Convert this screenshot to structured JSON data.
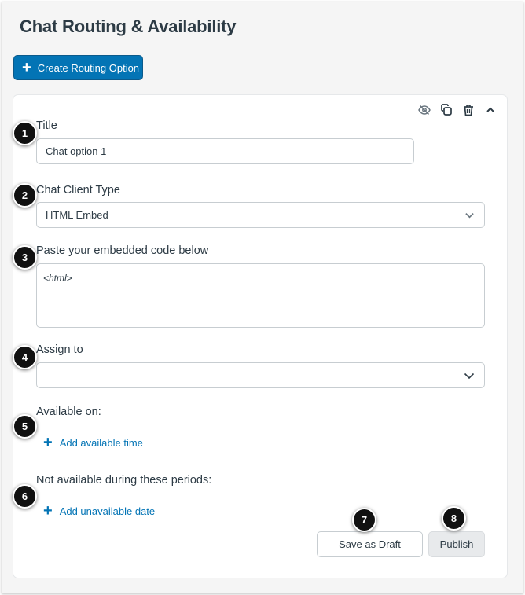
{
  "page": {
    "title": "Chat Routing & Availability"
  },
  "toolbar": {
    "create_label": "Create Routing Option"
  },
  "card": {
    "tools": [
      "eye-slash-icon",
      "copy-icon",
      "trash-icon",
      "chevron-up-icon"
    ],
    "title_label": "Title",
    "title_value": "Chat option 1",
    "client_type_label": "Chat Client Type",
    "client_type_value": "HTML Embed",
    "embed_label": "Paste your embedded code below",
    "embed_value": "<html>",
    "assign_label": "Assign to",
    "assign_value": "",
    "available_label": "Available on:",
    "add_available_label": "Add available time",
    "unavailable_label": "Not available during these periods:",
    "add_unavailable_label": "Add unavailable date",
    "save_draft_label": "Save as Draft",
    "publish_label": "Publish"
  },
  "callouts": [
    "1",
    "2",
    "3",
    "4",
    "5",
    "6",
    "7",
    "8"
  ],
  "colors": {
    "accent": "#0374b5",
    "text": "#2d3b45",
    "border": "#c7cdd1"
  }
}
